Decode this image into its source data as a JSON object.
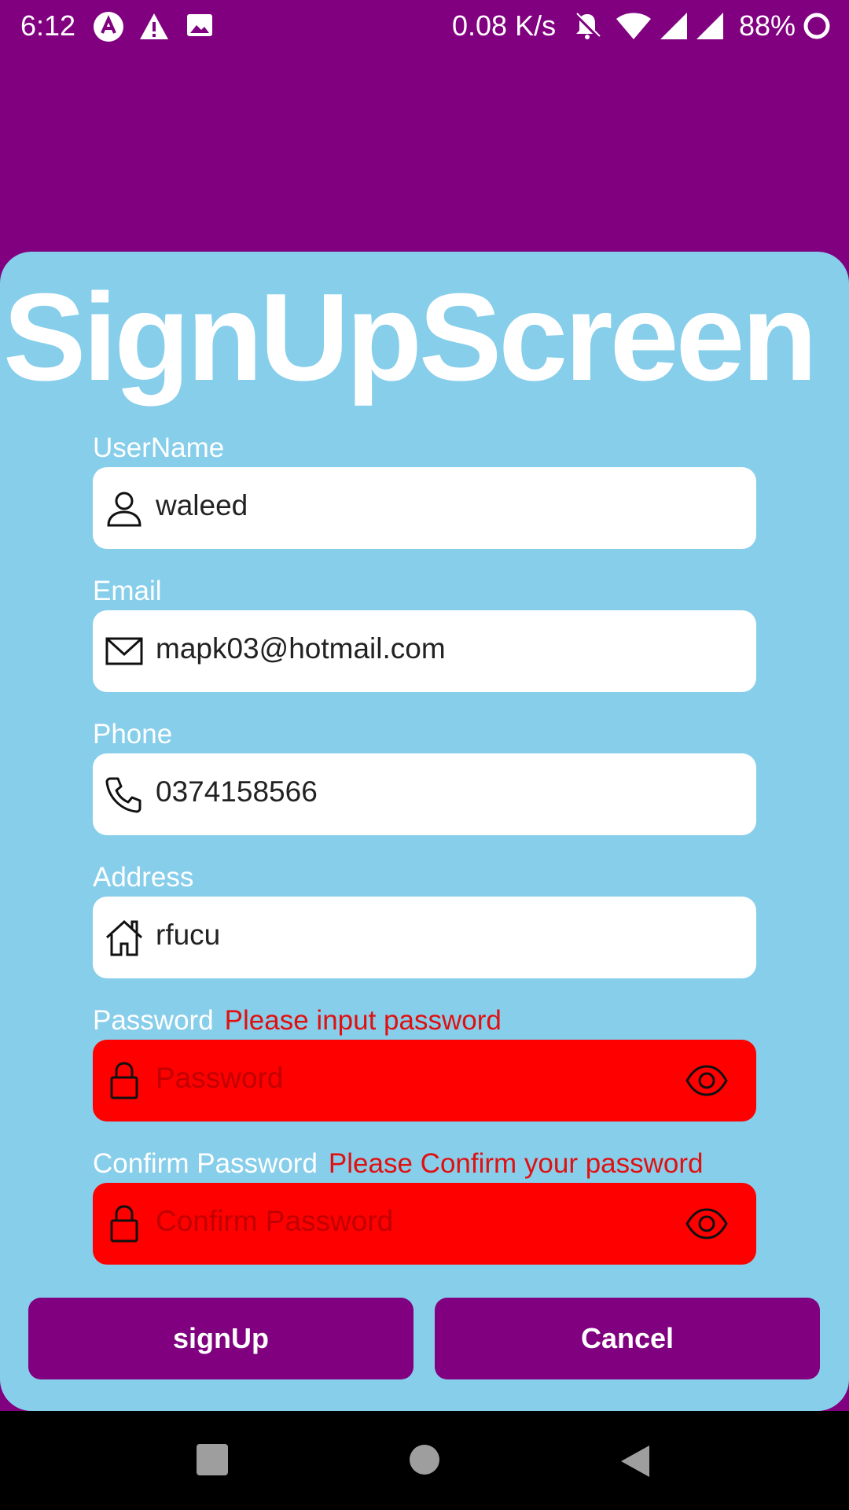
{
  "status_bar": {
    "time": "6:12",
    "net_speed": "0.08 K/s",
    "battery": "88%",
    "icons": [
      "arrow-icon",
      "warning-icon",
      "image-icon",
      "bell-off-icon",
      "wifi-icon",
      "signal-icon",
      "signal-icon",
      "battery-ring-icon"
    ]
  },
  "screen": {
    "title": "SignUpScreen"
  },
  "fields": {
    "username": {
      "label": "UserName",
      "value": "waleed",
      "icon": "person-icon"
    },
    "email": {
      "label": "Email",
      "value": "mapk03@hotmail.com",
      "icon": "mail-icon"
    },
    "phone": {
      "label": "Phone",
      "value": "0374158566",
      "icon": "phone-icon"
    },
    "address": {
      "label": "Address",
      "value": "rfucu",
      "icon": "home-icon"
    },
    "password": {
      "label": "Password",
      "error": "Please input password",
      "placeholder": "Password",
      "icon": "lock-icon"
    },
    "confirm_password": {
      "label": "Confirm Password",
      "error": "Please Confirm your password",
      "placeholder": "Confirm Password",
      "icon": "lock-icon"
    }
  },
  "buttons": {
    "signup": "signUp",
    "cancel": "Cancel"
  },
  "colors": {
    "background": "#800080",
    "card": "#87CEEB",
    "error": "#e01010",
    "error_field": "#ff0000",
    "button": "#800080"
  },
  "nav_bar": {
    "icons": [
      "recents-square-icon",
      "home-circle-icon",
      "back-triangle-icon"
    ]
  }
}
